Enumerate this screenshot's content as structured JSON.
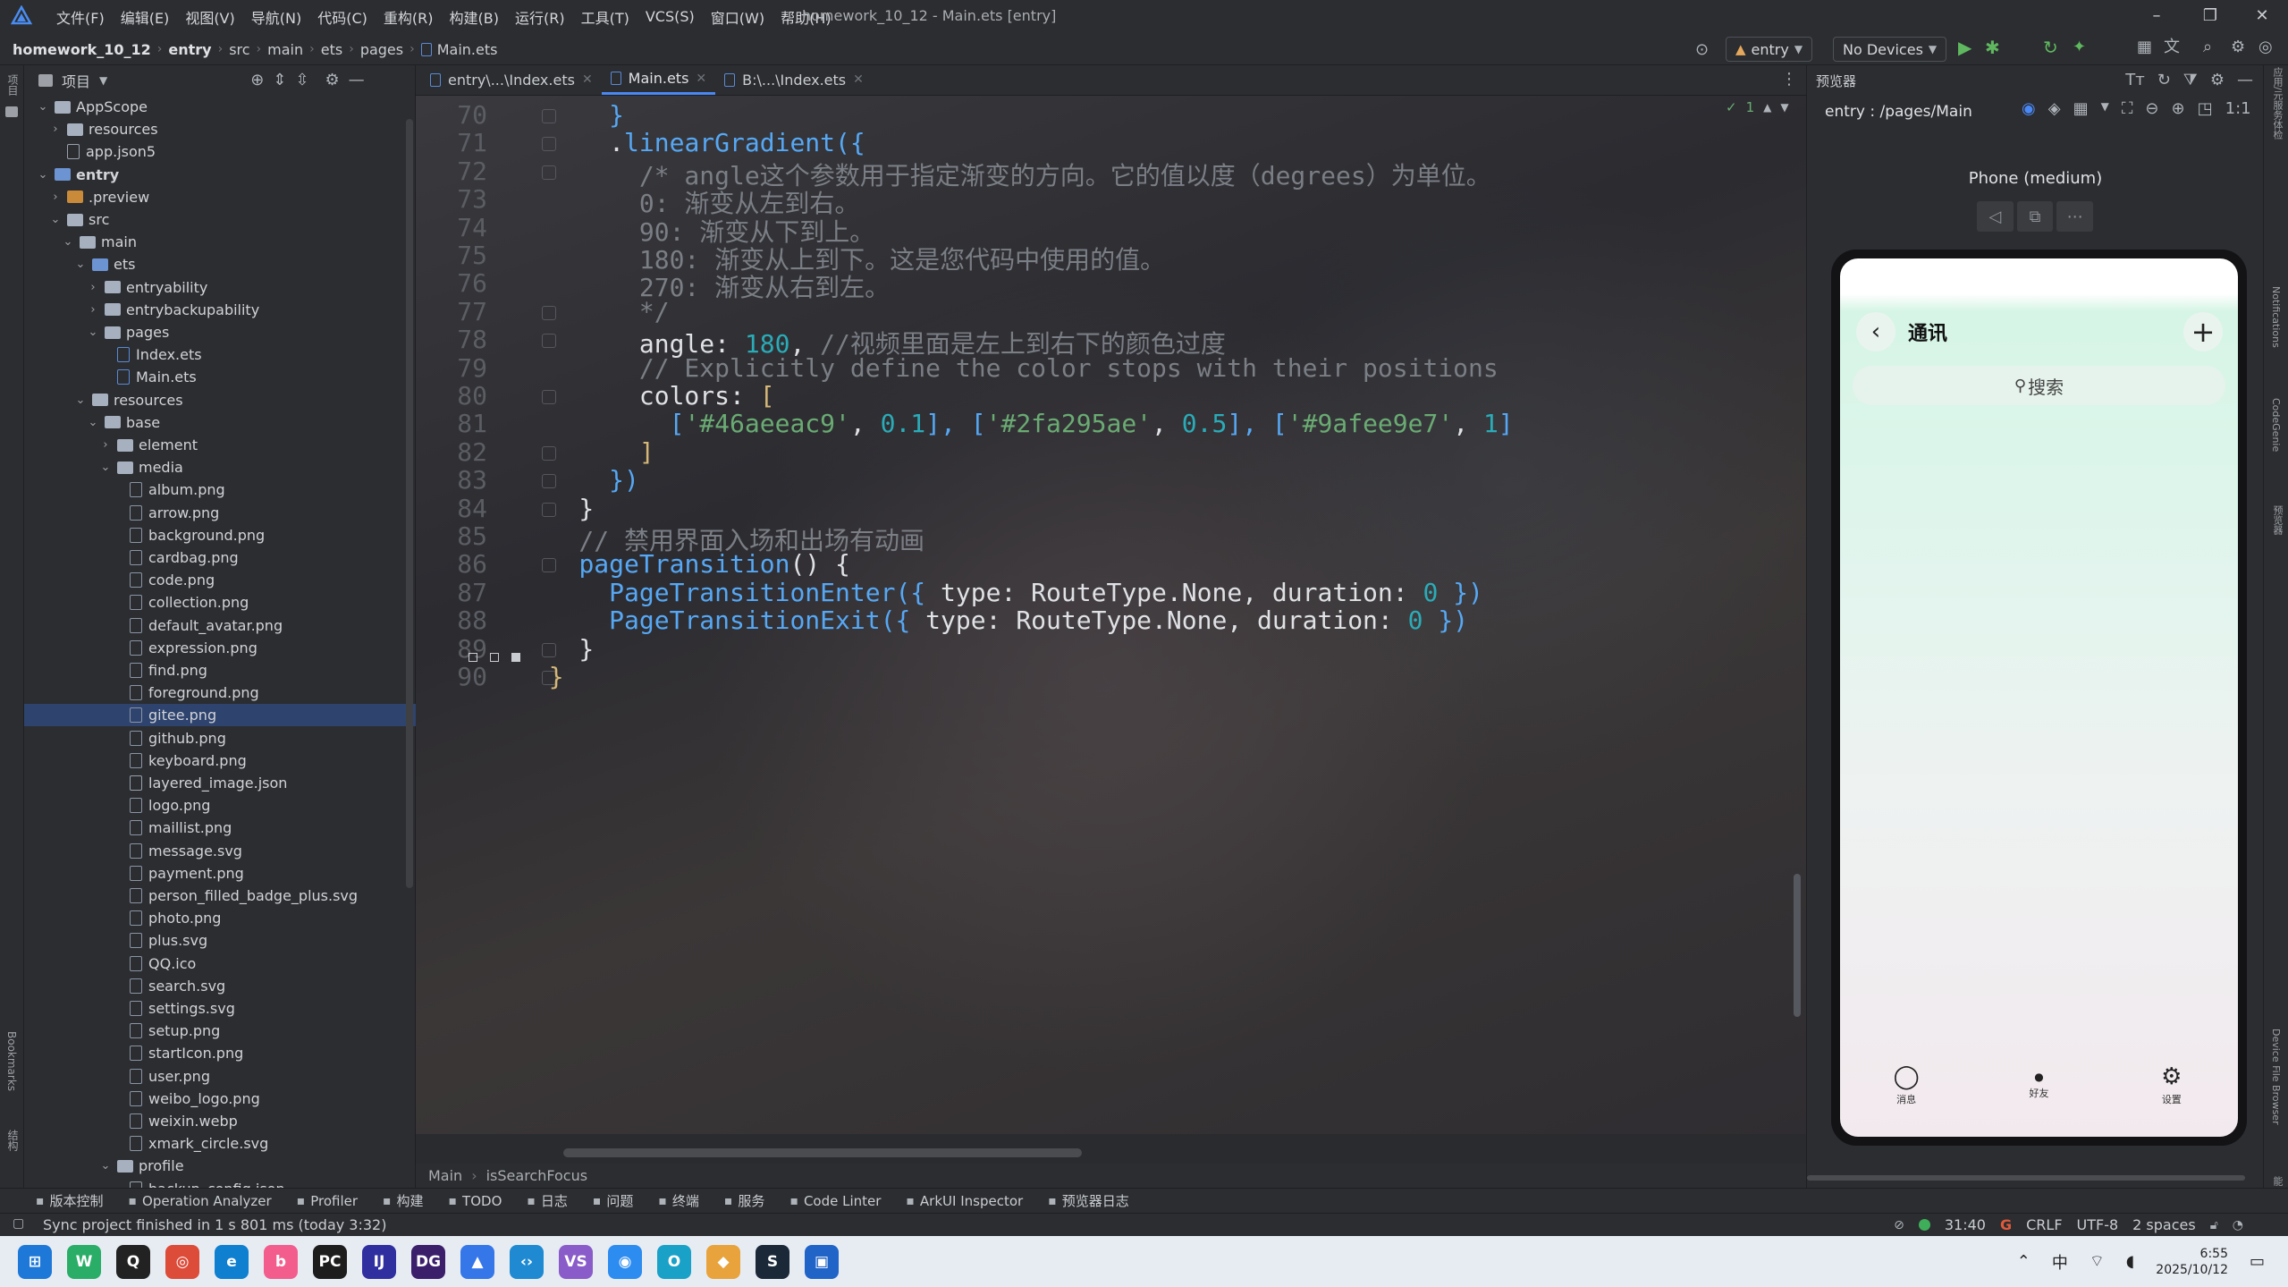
{
  "menu": {
    "items": [
      "文件(F)",
      "编辑(E)",
      "视图(V)",
      "导航(N)",
      "代码(C)",
      "重构(R)",
      "构建(B)",
      "运行(R)",
      "工具(T)",
      "VCS(S)",
      "窗口(W)",
      "帮助(H)"
    ],
    "window_title": "homework_10_12 - Main.ets [entry]"
  },
  "navbar": {
    "breadcrumb": [
      "homework_10_12",
      "entry",
      "src",
      "main",
      "ets",
      "pages",
      "Main.ets"
    ],
    "run_config": "entry",
    "device": "No Devices"
  },
  "left_stripe": {
    "top_label": "项目",
    "bookmarks": "Bookmarks",
    "structure": "结构"
  },
  "project": {
    "title": "项目",
    "tree": [
      {
        "label": "AppScope",
        "kind": "folder",
        "depth": 1,
        "expanded": true
      },
      {
        "label": "resources",
        "kind": "folder",
        "depth": 2,
        "expanded": false
      },
      {
        "label": "app.json5",
        "kind": "json",
        "depth": 2
      },
      {
        "label": "entry",
        "kind": "module",
        "depth": 1,
        "expanded": true,
        "bold": true
      },
      {
        "label": ".preview",
        "kind": "folder-orange",
        "depth": 2,
        "expanded": false
      },
      {
        "label": "src",
        "kind": "folder",
        "depth": 2,
        "expanded": true
      },
      {
        "label": "main",
        "kind": "folder",
        "depth": 3,
        "expanded": true
      },
      {
        "label": "ets",
        "kind": "folder-blue",
        "depth": 4,
        "expanded": true
      },
      {
        "label": "entryability",
        "kind": "folder",
        "depth": 5,
        "expanded": false
      },
      {
        "label": "entrybackupability",
        "kind": "folder",
        "depth": 5,
        "expanded": false
      },
      {
        "label": "pages",
        "kind": "folder",
        "depth": 5,
        "expanded": true
      },
      {
        "label": "Index.ets",
        "kind": "ets",
        "depth": 6
      },
      {
        "label": "Main.ets",
        "kind": "ets",
        "depth": 6
      },
      {
        "label": "resources",
        "kind": "folder",
        "depth": 4,
        "expanded": true
      },
      {
        "label": "base",
        "kind": "folder",
        "depth": 5,
        "expanded": true
      },
      {
        "label": "element",
        "kind": "folder",
        "depth": 6,
        "expanded": false
      },
      {
        "label": "media",
        "kind": "folder",
        "depth": 6,
        "expanded": true
      },
      {
        "label": "album.png",
        "kind": "file",
        "depth": 7
      },
      {
        "label": "arrow.png",
        "kind": "file",
        "depth": 7
      },
      {
        "label": "background.png",
        "kind": "file",
        "depth": 7
      },
      {
        "label": "cardbag.png",
        "kind": "file",
        "depth": 7
      },
      {
        "label": "code.png",
        "kind": "file",
        "depth": 7
      },
      {
        "label": "collection.png",
        "kind": "file",
        "depth": 7
      },
      {
        "label": "default_avatar.png",
        "kind": "file",
        "depth": 7
      },
      {
        "label": "expression.png",
        "kind": "file",
        "depth": 7
      },
      {
        "label": "find.png",
        "kind": "file",
        "depth": 7
      },
      {
        "label": "foreground.png",
        "kind": "file",
        "depth": 7
      },
      {
        "label": "gitee.png",
        "kind": "file",
        "depth": 7,
        "selected": true
      },
      {
        "label": "github.png",
        "kind": "file",
        "depth": 7
      },
      {
        "label": "keyboard.png",
        "kind": "file",
        "depth": 7
      },
      {
        "label": "layered_image.json",
        "kind": "json",
        "depth": 7
      },
      {
        "label": "logo.png",
        "kind": "file",
        "depth": 7
      },
      {
        "label": "maillist.png",
        "kind": "file",
        "depth": 7
      },
      {
        "label": "message.svg",
        "kind": "file",
        "depth": 7
      },
      {
        "label": "payment.png",
        "kind": "file",
        "depth": 7
      },
      {
        "label": "person_filled_badge_plus.svg",
        "kind": "file",
        "depth": 7
      },
      {
        "label": "photo.png",
        "kind": "file",
        "depth": 7
      },
      {
        "label": "plus.svg",
        "kind": "file",
        "depth": 7
      },
      {
        "label": "QQ.ico",
        "kind": "file",
        "depth": 7
      },
      {
        "label": "search.svg",
        "kind": "file",
        "depth": 7
      },
      {
        "label": "settings.svg",
        "kind": "file",
        "depth": 7
      },
      {
        "label": "setup.png",
        "kind": "file",
        "depth": 7
      },
      {
        "label": "startIcon.png",
        "kind": "file",
        "depth": 7
      },
      {
        "label": "user.png",
        "kind": "file",
        "depth": 7
      },
      {
        "label": "weibo_logo.png",
        "kind": "file",
        "depth": 7
      },
      {
        "label": "weixin.webp",
        "kind": "file",
        "depth": 7
      },
      {
        "label": "xmark_circle.svg",
        "kind": "file",
        "depth": 7
      },
      {
        "label": "profile",
        "kind": "folder",
        "depth": 6,
        "expanded": true
      },
      {
        "label": "backup_config.json",
        "kind": "json",
        "depth": 7
      }
    ]
  },
  "editor": {
    "tabs": [
      {
        "label": "entry\\...\\Index.ets",
        "active": false
      },
      {
        "label": "Main.ets",
        "active": true
      },
      {
        "label": "B:\\...\\Index.ets",
        "active": false
      }
    ],
    "problems_count": "1",
    "lines": [
      {
        "n": "70",
        "segs": [
          [
            "      ",
            "c-def"
          ],
          [
            "}",
            "c-fn"
          ]
        ]
      },
      {
        "n": "71",
        "segs": [
          [
            "      .",
            "c-def"
          ],
          [
            "linearGradient",
            "c-fn"
          ],
          [
            "({",
            "c-fn"
          ]
        ]
      },
      {
        "n": "72",
        "segs": [
          [
            "        /* angle这个参数用于指定渐变的方向。它的值以度（degrees）为单位。",
            "c-com"
          ]
        ]
      },
      {
        "n": "73",
        "segs": [
          [
            "        0: 渐变从左到右。",
            "c-com"
          ]
        ]
      },
      {
        "n": "74",
        "segs": [
          [
            "        90: 渐变从下到上。",
            "c-com"
          ]
        ]
      },
      {
        "n": "75",
        "segs": [
          [
            "        180: 渐变从上到下。这是您代码中使用的值。",
            "c-com"
          ]
        ]
      },
      {
        "n": "76",
        "segs": [
          [
            "        270: 渐变从右到左。",
            "c-com"
          ]
        ]
      },
      {
        "n": "77",
        "segs": [
          [
            "        */",
            "c-com"
          ]
        ]
      },
      {
        "n": "78",
        "segs": [
          [
            "        angle: ",
            "c-def"
          ],
          [
            "180",
            "c-num"
          ],
          [
            ", ",
            "c-def"
          ],
          [
            "//视频里面是左上到右下的颜色过度",
            "c-com"
          ]
        ]
      },
      {
        "n": "79",
        "segs": [
          [
            "        // Explicitly define the color stops with their positions",
            "c-com"
          ]
        ]
      },
      {
        "n": "80",
        "segs": [
          [
            "        colors: ",
            "c-def"
          ],
          [
            "[",
            "c-prop"
          ]
        ]
      },
      {
        "n": "81",
        "segs": [
          [
            "          ",
            "c-def"
          ],
          [
            "[",
            "c-fn"
          ],
          [
            "'#46aeeac9'",
            "c-str"
          ],
          [
            ", ",
            "c-def"
          ],
          [
            "0.1",
            "c-num"
          ],
          [
            "], ",
            "c-fn"
          ],
          [
            "[",
            "c-fn"
          ],
          [
            "'#2fa295ae'",
            "c-str"
          ],
          [
            ", ",
            "c-def"
          ],
          [
            "0.5",
            "c-num"
          ],
          [
            "], ",
            "c-fn"
          ],
          [
            "[",
            "c-fn"
          ],
          [
            "'#9afee9e7'",
            "c-str"
          ],
          [
            ", ",
            "c-def"
          ],
          [
            "1",
            "c-num"
          ],
          [
            "]",
            "c-fn"
          ]
        ]
      },
      {
        "n": "82",
        "segs": [
          [
            "        ",
            "c-def"
          ],
          [
            "]",
            "c-prop"
          ]
        ]
      },
      {
        "n": "83",
        "segs": [
          [
            "      ",
            "c-def"
          ],
          [
            "})",
            "c-fn"
          ]
        ]
      },
      {
        "n": "84",
        "segs": [
          [
            "    }",
            "c-def"
          ]
        ]
      },
      {
        "n": "85",
        "segs": [
          [
            "    // 禁用界面入场和出场有动画",
            "c-com"
          ]
        ]
      },
      {
        "n": "86",
        "segs": [
          [
            "    ",
            "c-def"
          ],
          [
            "pageTransition",
            "c-fn"
          ],
          [
            "() {",
            "c-def"
          ]
        ]
      },
      {
        "n": "87",
        "segs": [
          [
            "      ",
            "c-def"
          ],
          [
            "PageTransitionEnter",
            "c-fn"
          ],
          [
            "({ ",
            "c-fn"
          ],
          [
            "type",
            "c-def"
          ],
          [
            ": RouteType.None, ",
            "c-def"
          ],
          [
            "duration",
            "c-def"
          ],
          [
            ": ",
            "c-def"
          ],
          [
            "0",
            "c-num"
          ],
          [
            " })",
            "c-fn"
          ]
        ]
      },
      {
        "n": "88",
        "segs": [
          [
            "      ",
            "c-def"
          ],
          [
            "PageTransitionExit",
            "c-fn"
          ],
          [
            "({ ",
            "c-fn"
          ],
          [
            "type",
            "c-def"
          ],
          [
            ": RouteType.None, ",
            "c-def"
          ],
          [
            "duration",
            "c-def"
          ],
          [
            ": ",
            "c-def"
          ],
          [
            "0",
            "c-num"
          ],
          [
            " })",
            "c-fn"
          ]
        ]
      },
      {
        "n": "89",
        "segs": [
          [
            "    }",
            "c-def"
          ]
        ]
      },
      {
        "n": "90",
        "segs": [
          [
            "  }",
            "c-prop"
          ]
        ]
      }
    ],
    "breadcrumb": [
      "Main",
      "isSearchFocus"
    ]
  },
  "preview": {
    "header": "预览器",
    "path": "entry : /pages/Main",
    "device_name": "Phone (medium)",
    "app": {
      "title": "通讯",
      "search_placeholder": "搜索",
      "nav": [
        {
          "label": "消息",
          "icon": "chat-icon"
        },
        {
          "label": "好友",
          "icon": "dot-icon"
        },
        {
          "label": "设置",
          "icon": "gear-icon"
        }
      ]
    }
  },
  "right_stripe": [
    "应用/元服务体检",
    "Notifications",
    "CodeGenie",
    "预览器",
    "Device File Browser",
    "新功能"
  ],
  "tool_windows": [
    "版本控制",
    "Operation Analyzer",
    "Profiler",
    "构建",
    "TODO",
    "日志",
    "问题",
    "终端",
    "服务",
    "Code Linter",
    "ArkUI Inspector",
    "预览器日志"
  ],
  "status": {
    "message": "Sync project finished in 1 s 801 ms (today 3:32)",
    "position": "31:40",
    "line_ending": "CRLF",
    "encoding": "UTF-8",
    "indent": "2 spaces"
  },
  "taskbar": {
    "ime": "中",
    "time": "6:55",
    "date": "2025/10/12",
    "apps": [
      {
        "name": "start-icon",
        "color": "#1e78d7",
        "glyph": "⊞"
      },
      {
        "name": "wechat-icon",
        "color": "#2aae67",
        "glyph": "W"
      },
      {
        "name": "qq-icon",
        "color": "#222222",
        "glyph": "Q"
      },
      {
        "name": "chrome-icon",
        "color": "#dd4b39",
        "glyph": "◎"
      },
      {
        "name": "edge-icon",
        "color": "#0f7fd0",
        "glyph": "e"
      },
      {
        "name": "bilibili-icon",
        "color": "#f25d8e",
        "glyph": "b"
      },
      {
        "name": "pycharm-icon",
        "color": "#1d1d1d",
        "glyph": "PC"
      },
      {
        "name": "intellij-icon",
        "color": "#2f2fa0",
        "glyph": "IJ"
      },
      {
        "name": "datagrip-icon",
        "color": "#3b1f6b",
        "glyph": "DG"
      },
      {
        "name": "deveco-icon",
        "color": "#3576e8",
        "glyph": "▲"
      },
      {
        "name": "vscode-icon",
        "color": "#1f8ad2",
        "glyph": "‹›"
      },
      {
        "name": "visual-studio-icon",
        "color": "#8a5cc9",
        "glyph": "VS"
      },
      {
        "name": "browser-icon",
        "color": "#2d8cf0",
        "glyph": "◉"
      },
      {
        "name": "office-icon",
        "color": "#1aa1c7",
        "glyph": "O"
      },
      {
        "name": "git-tool-icon",
        "color": "#e8a33c",
        "glyph": "◆"
      },
      {
        "name": "steam-icon",
        "color": "#1b2838",
        "glyph": "S"
      },
      {
        "name": "store-icon",
        "color": "#2064c8",
        "glyph": "▣"
      }
    ]
  }
}
